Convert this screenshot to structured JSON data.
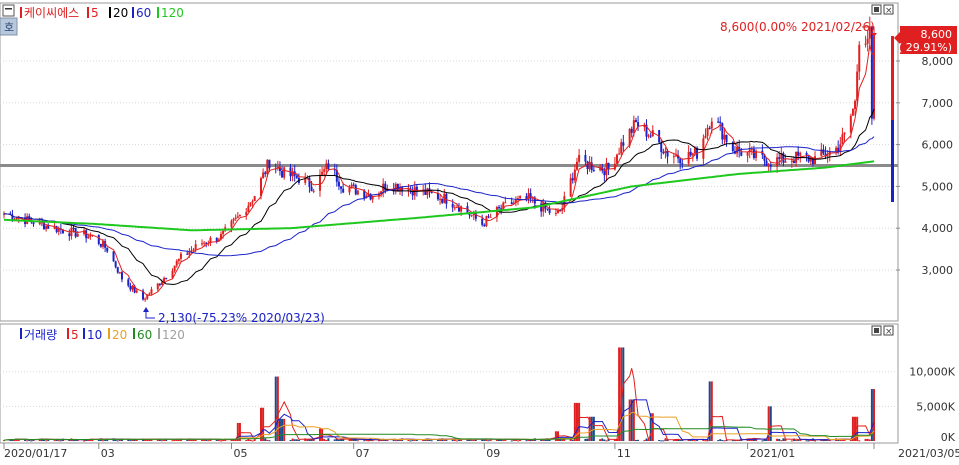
{
  "price_panel": {
    "legend": {
      "name": "케이씨에스",
      "ma": [
        {
          "label": "5",
          "color": "#e02020"
        },
        {
          "label": "20",
          "color": "#000000"
        },
        {
          "label": "60",
          "color": "#1a22c8"
        },
        {
          "label": "120",
          "color": "#1ec81e"
        }
      ]
    },
    "high_annotation": "8,600(0.00% 2021/02/26)",
    "low_annotation": "2,130(-75.23% 2020/03/23)",
    "current_price": "8,600",
    "current_change": "( 29.91%)",
    "y_ticks": [
      "8,000",
      "7,000",
      "6,000",
      "5,000",
      "4,000",
      "3,000"
    ]
  },
  "volume_panel": {
    "legend": {
      "name": "거래량",
      "ma": [
        {
          "label": "5",
          "color": "#e02020"
        },
        {
          "label": "10",
          "color": "#1a22c8"
        },
        {
          "label": "20",
          "color": "#e8a020"
        },
        {
          "label": "60",
          "color": "#208a20"
        },
        {
          "label": "120",
          "color": "#a0a0a0"
        }
      ]
    },
    "y_ticks": [
      "10,000K",
      "5,000K",
      "0K"
    ]
  },
  "x_axis_labels": [
    "2020/01/17",
    "03",
    "05",
    "07",
    "09",
    "11",
    "2021/01",
    "2021/03/05"
  ],
  "colors": {
    "up": "#e02020",
    "down": "#1a22c8",
    "ma5": "#e02020",
    "ma20": "#000000",
    "ma60": "#1a22c8",
    "ma120": "#1ec81e",
    "hline": "#808080"
  },
  "chart_data": {
    "type": "candlestick",
    "y_range": [
      2000,
      8600
    ],
    "horizontal_line": 5500,
    "x_start": "2020/01/17",
    "x_end": "2021/03/05",
    "close_anchors": [
      [
        "2020/01/17",
        4350
      ],
      [
        "2020/01/31",
        4150
      ],
      [
        "2020/02/14",
        3950
      ],
      [
        "2020/02/28",
        3800
      ],
      [
        "2020/03/06",
        3500
      ],
      [
        "2020/03/13",
        2800
      ],
      [
        "2020/03/23",
        2300
      ],
      [
        "2020/03/31",
        2700
      ],
      [
        "2020/04/10",
        3300
      ],
      [
        "2020/04/20",
        3650
      ],
      [
        "2020/04/29",
        3800
      ],
      [
        "2020/05/08",
        4300
      ],
      [
        "2020/05/15",
        4800
      ],
      [
        "2020/05/22",
        5600
      ],
      [
        "2020/05/29",
        5300
      ],
      [
        "2020/06/05",
        5200
      ],
      [
        "2020/06/12",
        5000
      ],
      [
        "2020/06/19",
        5500
      ],
      [
        "2020/06/26",
        5000
      ],
      [
        "2020/07/03",
        4900
      ],
      [
        "2020/07/10",
        4800
      ],
      [
        "2020/07/17",
        5050
      ],
      [
        "2020/07/24",
        5000
      ],
      [
        "2020/07/31",
        4900
      ],
      [
        "2020/08/07",
        4800
      ],
      [
        "2020/08/14",
        4700
      ],
      [
        "2020/08/21",
        4500
      ],
      [
        "2020/08/31",
        4100
      ],
      [
        "2020/09/07",
        4400
      ],
      [
        "2020/09/14",
        4600
      ],
      [
        "2020/09/22",
        4700
      ],
      [
        "2020/10/05",
        4300
      ],
      [
        "2020/10/08",
        4500
      ],
      [
        "2020/10/15",
        5600
      ],
      [
        "2020/10/22",
        5500
      ],
      [
        "2020/10/30",
        5400
      ],
      [
        "2020/11/05",
        6000
      ],
      [
        "2020/11/12",
        6500
      ],
      [
        "2020/11/20",
        6200
      ],
      [
        "2020/11/27",
        5800
      ],
      [
        "2020/12/04",
        5700
      ],
      [
        "2020/12/11",
        5800
      ],
      [
        "2020/12/18",
        6700
      ],
      [
        "2020/12/28",
        5900
      ],
      [
        "2021/01/08",
        5700
      ],
      [
        "2021/01/15",
        5600
      ],
      [
        "2021/01/22",
        5650
      ],
      [
        "2021/01/29",
        5700
      ],
      [
        "2021/02/05",
        5650
      ],
      [
        "2021/02/15",
        5900
      ],
      [
        "2021/02/19",
        6200
      ],
      [
        "2021/02/24",
        7000
      ],
      [
        "2021/02/26",
        8600
      ],
      [
        "2021/03/05",
        8600
      ]
    ],
    "ma120_anchors": [
      [
        "2020/01/17",
        4200
      ],
      [
        "2020/03/01",
        4100
      ],
      [
        "2020/04/15",
        3950
      ],
      [
        "2020/06/01",
        4000
      ],
      [
        "2020/08/01",
        4250
      ],
      [
        "2020/09/25",
        4500
      ],
      [
        "2020/11/10",
        5000
      ],
      [
        "2020/12/31",
        5300
      ],
      [
        "2021/02/10",
        5450
      ],
      [
        "2021/03/05",
        5600
      ]
    ],
    "volume_spikes_k": [
      [
        "2020/05/08",
        2600
      ],
      [
        "2020/05/18",
        4800
      ],
      [
        "2020/05/25",
        9300
      ],
      [
        "2020/05/28",
        3200
      ],
      [
        "2020/06/15",
        1800
      ],
      [
        "2020/10/05",
        1400
      ],
      [
        "2020/10/15",
        5500
      ],
      [
        "2020/10/22",
        3500
      ],
      [
        "2020/11/05",
        13500
      ],
      [
        "2020/11/10",
        6000
      ],
      [
        "2020/11/20",
        4000
      ],
      [
        "2020/12/18",
        8600
      ],
      [
        "2021/01/15",
        5000
      ],
      [
        "2021/02/24",
        3500
      ],
      [
        "2021/03/05",
        7500
      ]
    ],
    "volume_y_range": [
      0,
      14000
    ]
  }
}
